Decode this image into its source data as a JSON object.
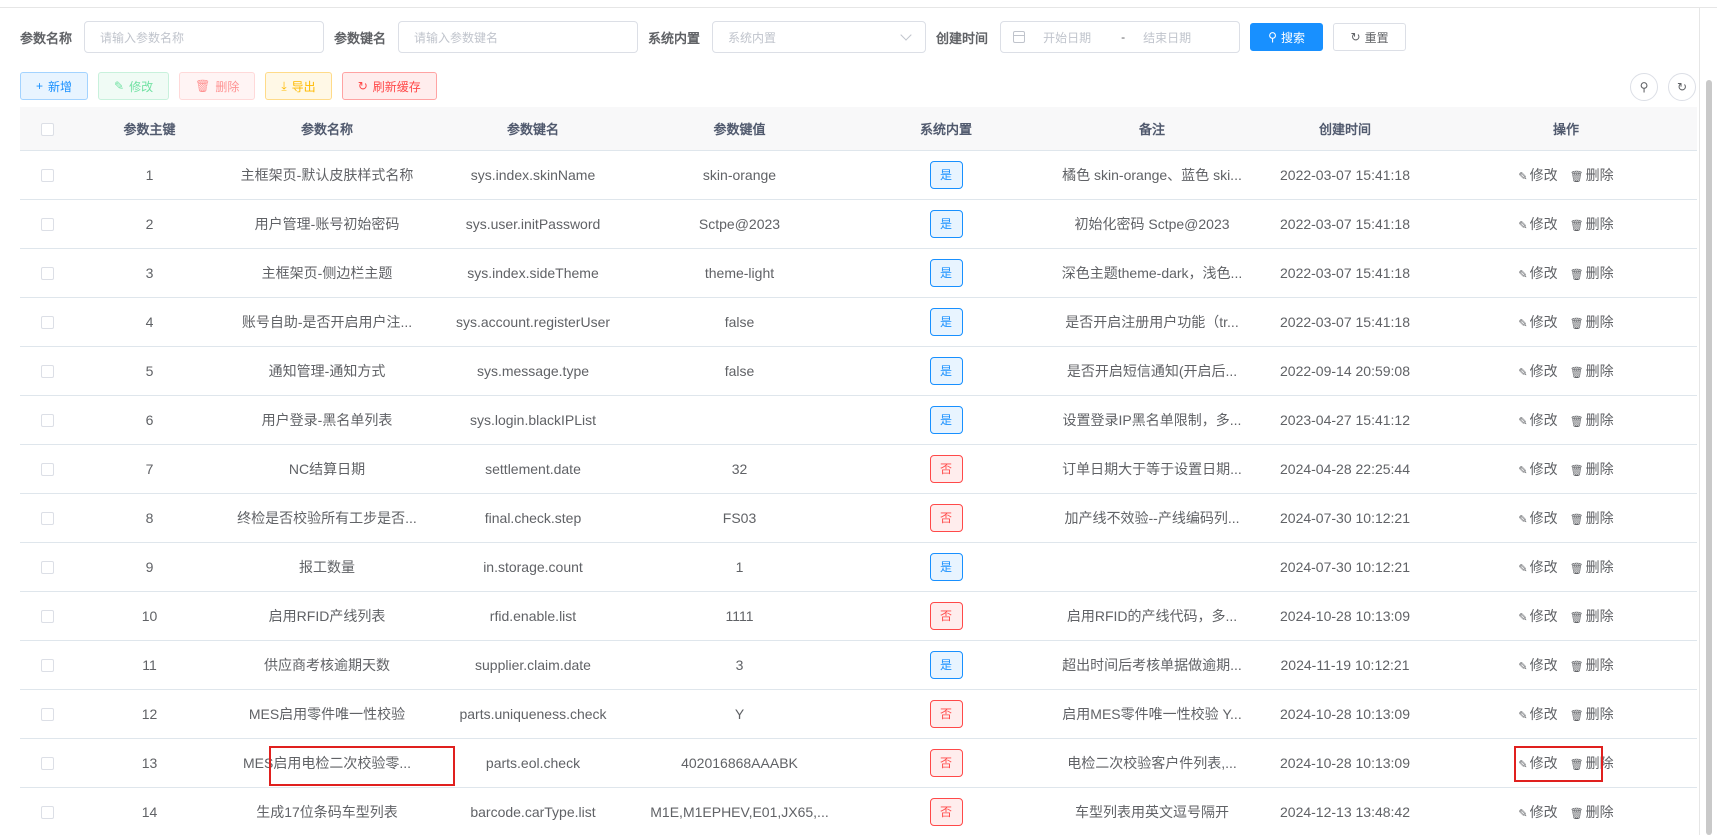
{
  "search": {
    "param_name_label": "参数名称",
    "param_name_placeholder": "请输入参数名称",
    "param_key_label": "参数键名",
    "param_key_placeholder": "请输入参数键名",
    "builtin_label": "系统内置",
    "builtin_placeholder": "系统内置",
    "created_label": "创建时间",
    "start_placeholder": "开始日期",
    "date_separator": "-",
    "end_placeholder": "结束日期",
    "search_button": "搜索",
    "reset_button": "重置"
  },
  "toolbar": {
    "add": "新增",
    "edit": "修改",
    "delete": "删除",
    "export": "导出",
    "refresh_cache": "刷新缓存"
  },
  "table": {
    "columns": [
      "参数主键",
      "参数名称",
      "参数键名",
      "参数键值",
      "系统内置",
      "备注",
      "创建时间",
      "操作"
    ],
    "edit_label": "修改",
    "delete_label": "删除",
    "rows": [
      {
        "id": "1",
        "name": "主框架页-默认皮肤样式名称",
        "key": "sys.index.skinName",
        "value": "skin-orange",
        "builtin": "是",
        "remark": "橘色 skin-orange、蓝色 ski...",
        "created": "2022-03-07 15:41:18"
      },
      {
        "id": "2",
        "name": "用户管理-账号初始密码",
        "key": "sys.user.initPassword",
        "value": "Sctpe@2023",
        "builtin": "是",
        "remark": "初始化密码 Sctpe@2023",
        "created": "2022-03-07 15:41:18"
      },
      {
        "id": "3",
        "name": "主框架页-侧边栏主题",
        "key": "sys.index.sideTheme",
        "value": "theme-light",
        "builtin": "是",
        "remark": "深色主题theme-dark，浅色...",
        "created": "2022-03-07 15:41:18"
      },
      {
        "id": "4",
        "name": "账号自助-是否开启用户注...",
        "key": "sys.account.registerUser",
        "value": "false",
        "builtin": "是",
        "remark": "是否开启注册用户功能（tr...",
        "created": "2022-03-07 15:41:18"
      },
      {
        "id": "5",
        "name": "通知管理-通知方式",
        "key": "sys.message.type",
        "value": "false",
        "builtin": "是",
        "remark": "是否开启短信通知(开启后...",
        "created": "2022-09-14 20:59:08"
      },
      {
        "id": "6",
        "name": "用户登录-黑名单列表",
        "key": "sys.login.blackIPList",
        "value": "",
        "builtin": "是",
        "remark": "设置登录IP黑名单限制，多...",
        "created": "2023-04-27 15:41:12"
      },
      {
        "id": "7",
        "name": "NC结算日期",
        "key": "settlement.date",
        "value": "32",
        "builtin": "否",
        "remark": "订单日期大于等于设置日期...",
        "created": "2024-04-28 22:25:44"
      },
      {
        "id": "8",
        "name": "终检是否校验所有工步是否...",
        "key": "final.check.step",
        "value": "FS03",
        "builtin": "否",
        "remark": "加产线不效验--产线编码列...",
        "created": "2024-07-30 10:12:21"
      },
      {
        "id": "9",
        "name": "报工数量",
        "key": "in.storage.count",
        "value": "1",
        "builtin": "是",
        "remark": "",
        "created": "2024-07-30 10:12:21"
      },
      {
        "id": "10",
        "name": "启用RFID产线列表",
        "key": "rfid.enable.list",
        "value": "1111",
        "builtin": "否",
        "remark": "启用RFID的产线代码，多...",
        "created": "2024-10-28 10:13:09"
      },
      {
        "id": "11",
        "name": "供应商考核逾期天数",
        "key": "supplier.claim.date",
        "value": "3",
        "builtin": "是",
        "remark": "超出时间后考核单据做逾期...",
        "created": "2024-11-19 10:12:21"
      },
      {
        "id": "12",
        "name": "MES启用零件唯一性校验",
        "key": "parts.uniqueness.check",
        "value": "Y",
        "builtin": "否",
        "remark": "启用MES零件唯一性校验 Y...",
        "created": "2024-10-28 10:13:09"
      },
      {
        "id": "13",
        "name": "MES启用电检二次校验零...",
        "key": "parts.eol.check",
        "value": "402016868AAABK",
        "builtin": "否",
        "remark": "电检二次校验客户件列表,...",
        "created": "2024-10-28 10:13:09"
      },
      {
        "id": "14",
        "name": "生成17位条码车型列表",
        "key": "barcode.carType.list",
        "value": "M1E,M1EPHEV,E01,JX65,...",
        "builtin": "否",
        "remark": "车型列表用英文逗号隔开",
        "created": "2024-12-13 13:48:42"
      }
    ]
  }
}
